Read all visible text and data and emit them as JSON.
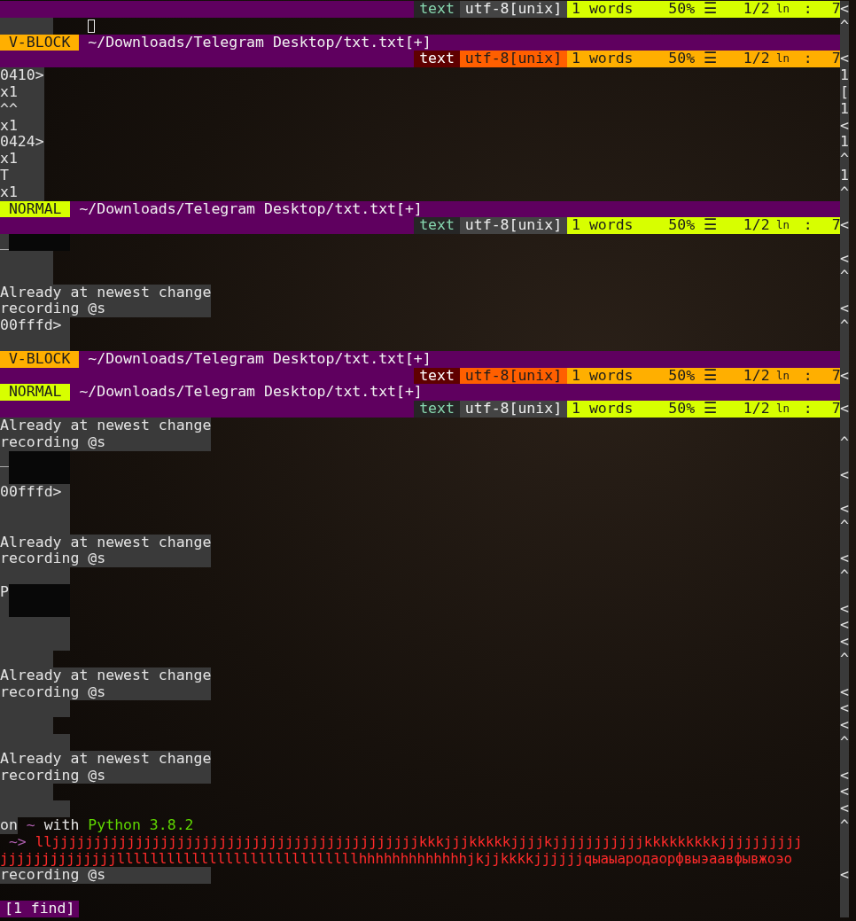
{
  "terminal": {
    "rows": [
      {
        "kind": "status",
        "visual": false,
        "filetype": "text",
        "encoding": "utf-8[unix]",
        "words": "1 words",
        "percent": "50%",
        "menu_glyph": "☰",
        "position": "1/2",
        "line_label": "ln",
        "separator": ":",
        "column": "7",
        "gutter": "<"
      },
      {
        "kind": "cursor",
        "gutter": "^"
      },
      {
        "kind": "mode",
        "visual": true,
        "label": "V-BLOCK",
        "path": "~/Downloads/Telegram Desktop/txt.txt[+]"
      },
      {
        "kind": "status",
        "visual": true,
        "filetype": "text",
        "encoding": "utf-8[unix]",
        "words": "1 words",
        "percent": "50%",
        "menu_glyph": "☰",
        "position": "1/2",
        "line_label": "ln",
        "separator": ":",
        "column": "7",
        "gutter": "<"
      },
      {
        "kind": "short",
        "text": "0410>",
        "gutter": "1"
      },
      {
        "kind": "short",
        "text": "x1",
        "gutter": "["
      },
      {
        "kind": "short",
        "text": "^^",
        "gutter": "1"
      },
      {
        "kind": "short",
        "text": "x1",
        "gutter": "<"
      },
      {
        "kind": "short",
        "text": "0424>",
        "gutter": "1"
      },
      {
        "kind": "short",
        "text": "x1",
        "gutter": "^"
      },
      {
        "kind": "short",
        "text": "T",
        "gutter": "1"
      },
      {
        "kind": "short",
        "text": "x1",
        "gutter": "^"
      },
      {
        "kind": "mode",
        "visual": false,
        "label": "NORMAL",
        "path": "~/Downloads/Telegram Desktop/txt.txt[+]"
      },
      {
        "kind": "status",
        "visual": false,
        "filetype": "text",
        "encoding": "utf-8[unix]",
        "words": "1 words",
        "percent": "50%",
        "menu_glyph": "☰",
        "position": "1/2",
        "line_label": "ln",
        "separator": ":",
        "column": "7",
        "gutter": "<"
      },
      {
        "kind": "notch",
        "text": "_"
      },
      {
        "kind": "narrow",
        "gutter": "<"
      },
      {
        "kind": "narrow",
        "gutter": "^"
      },
      {
        "kind": "message",
        "text": "Already at newest change"
      },
      {
        "kind": "message",
        "text": "recording @s",
        "gutter": "<"
      },
      {
        "kind": "block",
        "text": "00fffd>",
        "gutter": "^"
      },
      {
        "kind": "block"
      },
      {
        "kind": "mode",
        "visual": true,
        "label": "V-BLOCK",
        "path": "~/Downloads/Telegram Desktop/txt.txt[+]"
      },
      {
        "kind": "status",
        "visual": true,
        "filetype": "text",
        "encoding": "utf-8[unix]",
        "words": "1 words",
        "percent": "50%",
        "menu_glyph": "☰",
        "position": "1/2",
        "line_label": "ln",
        "separator": ":",
        "column": "7",
        "gutter": "<"
      },
      {
        "kind": "mode",
        "visual": false,
        "label": "NORMAL",
        "path": "~/Downloads/Telegram Desktop/txt.txt[+]"
      },
      {
        "kind": "status",
        "visual": false,
        "filetype": "text",
        "encoding": "utf-8[unix]",
        "words": "1 words",
        "percent": "50%",
        "menu_glyph": "☰",
        "position": "1/2",
        "line_label": "ln",
        "separator": ":",
        "column": "7",
        "gutter": "<"
      },
      {
        "kind": "message",
        "text": "Already at newest change"
      },
      {
        "kind": "message",
        "text": "recording @s",
        "gutter": "^"
      },
      {
        "kind": "notch",
        "text": "_"
      },
      {
        "kind": "notch",
        "gutter": "<"
      },
      {
        "kind": "block",
        "text": "00fffd>"
      },
      {
        "kind": "block",
        "gutter": "<"
      },
      {
        "kind": "block",
        "gutter": "^"
      },
      {
        "kind": "message",
        "text": "Already at newest change"
      },
      {
        "kind": "message",
        "text": "recording @s",
        "gutter": "<"
      },
      {
        "kind": "block",
        "gutter": "^"
      },
      {
        "kind": "notch",
        "text": "P"
      },
      {
        "kind": "notch",
        "gutter": "<"
      },
      {
        "kind": "block",
        "gutter": "<"
      },
      {
        "kind": "block",
        "gutter": "<"
      },
      {
        "kind": "narrow",
        "gutter": "^"
      },
      {
        "kind": "message",
        "text": "Already at newest change"
      },
      {
        "kind": "message",
        "text": "recording @s",
        "gutter": "<"
      },
      {
        "kind": "block",
        "gutter": "<"
      },
      {
        "kind": "narrow",
        "gutter": "<"
      },
      {
        "kind": "block",
        "gutter": "^"
      },
      {
        "kind": "message",
        "text": "Already at newest change"
      },
      {
        "kind": "message",
        "text": "recording @s",
        "gutter": "<"
      },
      {
        "kind": "narrow",
        "gutter": "<"
      },
      {
        "kind": "block",
        "gutter": "<"
      },
      {
        "kind": "prompt",
        "parts": [
          {
            "text": "on",
            "color": "#e4e4e4"
          },
          {
            "text": "~",
            "color": "#af5faf"
          },
          {
            "text": "with",
            "color": "#e4e4e4"
          },
          {
            "text": "Python 3.8.2",
            "color": "#5fd700"
          }
        ],
        "gutter": "^"
      },
      {
        "kind": "input",
        "arrow": "~>",
        "text": "lljjjjjjjjjjjjjjjjjjjjjjjjjjjjjjjjjjjjjjjjjjjjkkkjjjkkkkkjjjjkjjjjjjjjjjjkkkkkkkkkjjjjjjjjjj"
      },
      {
        "kind": "input",
        "text": "jjjjjjjjjjjjjjlllllllllllllllllllllllllllllhhhhhhhhhhhhhjkjjkkkkjjjjjjqыаыародаорфвыэаавфывжоэо"
      },
      {
        "kind": "message",
        "text": "recording @s",
        "gutter": "<"
      },
      {
        "kind": "clear"
      },
      {
        "kind": "find",
        "text": "[1 find]"
      }
    ]
  }
}
